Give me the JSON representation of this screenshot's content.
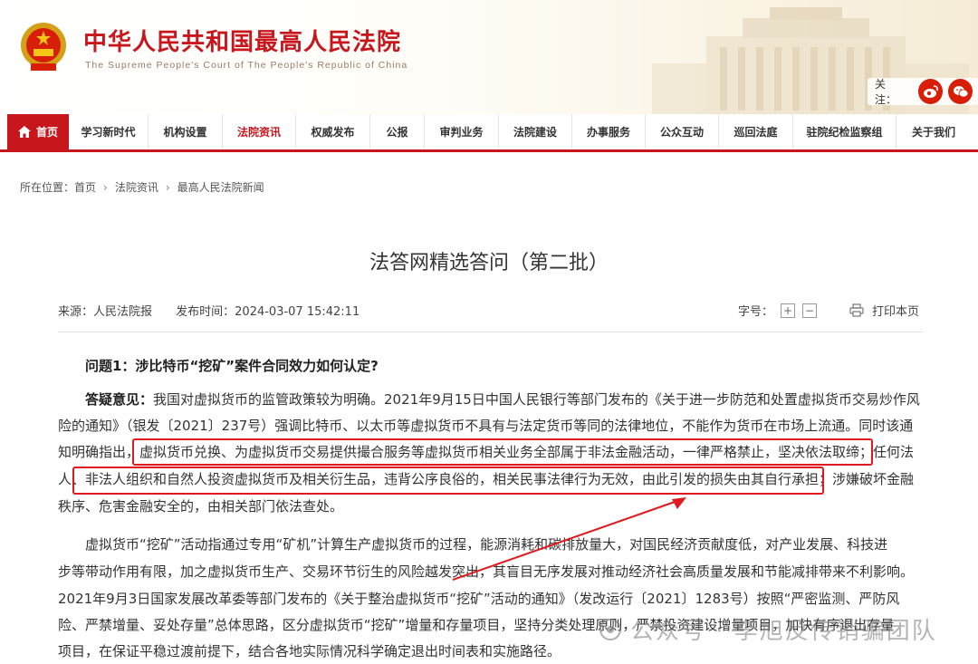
{
  "header": {
    "title": "中华人民共和国最高人民法院",
    "subtitle": "The Supreme People's Court of The People's Republic of China",
    "follow_label": "关注："
  },
  "nav": {
    "home": "首页",
    "items": [
      "学习新时代",
      "机构设置",
      "法院资讯",
      "权威发布",
      "公报",
      "审判业务",
      "法院建设",
      "办事服务",
      "公众互动",
      "巡回法庭",
      "驻院纪检监察组",
      "关于我们"
    ]
  },
  "breadcrumb": {
    "label": "所在位置：",
    "items": [
      "首页",
      "法院资讯",
      "最高人民法院新闻"
    ]
  },
  "article": {
    "title": "法答网精选答问（第二批）",
    "source": "来源：人民法院报",
    "time": "发布时间：2024-03-07 15:42:11",
    "font_size_label": "字号：",
    "font_plus": "+",
    "font_minus": "−",
    "print": "打印本页",
    "question": "问题1：涉比特币“挖矿”案件合同效力如何认定?",
    "answer_label": "答疑意见：",
    "p1": [
      "我国对虚拟货币的监管政策较为明确。2021年9月15日中国人民银行等部门发布的《关于进一步防范和处置虚拟货币交易炒作风",
      "险的通知》（银发〔2021〕237号）强调比特币、以太币等虚拟货币不具有与法定货币等同的法律地位，不能作为货币在市场上流通。同时该通",
      "知明确指出，虚拟货币兑换、为虚拟货币交易提供撮合服务等虚拟货币相关业务全部属于非法金融活动，一律严格禁止，坚决依法取缔；任何法",
      "人、非法人组织和自然人投资虚拟货币及相关衍生品，违背公序良俗的，相关民事法律行为无效，由此引发的损失由其自行承担；涉嫌破坏金融",
      "秩序、危害金融安全的，由相关部门依法查处。"
    ],
    "p2": [
      "虚拟货币“挖矿”活动指通过专用“矿机”计算生产虚拟货币的过程，能源消耗和碳排放量大，对国民经济贡献度低，对产业发展、科技进",
      "步等带动作用有限，加之虚拟货币生产、交易环节衍生的风险越发突出，其盲目无序发展对推动经济社会高质量发展和节能减排带来不利影响。",
      "2021年9月3日国家发展改革委等部门发布的《关于整治虚拟货币“挖矿”活动的通知》（发改运行〔2021〕1283号）按照“严密监测、严防风",
      "险、严禁增量、妥处存量”总体思路，区分虚拟货币“挖矿”增量和存量项目，坚持分类处理原则，严禁投资建设增量项目，加快有序退出存量",
      "项目，在保证平稳过渡前提下，结合各地实际情况科学确定退出时间表和实施路径。"
    ]
  },
  "watermark": "公众号 · 李旭反传销骗团队",
  "colors": {
    "brand_red": "#c8161d",
    "highlight_red": "#e0191e"
  }
}
